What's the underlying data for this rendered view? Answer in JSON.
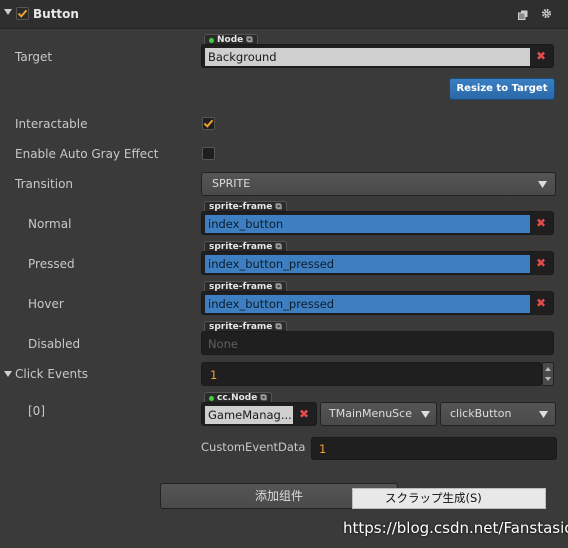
{
  "component": {
    "title": "Button",
    "enabled": true,
    "icons": [
      "copy-icon",
      "gear-icon"
    ]
  },
  "target": {
    "label": "Target",
    "tag": "Node",
    "value": "Background"
  },
  "resize_button": "Resize to Target",
  "interactable": {
    "label": "Interactable",
    "checked": true
  },
  "auto_gray": {
    "label": "Enable Auto Gray Effect",
    "checked": false
  },
  "transition": {
    "label": "Transition",
    "value": "SPRITE"
  },
  "states": [
    {
      "label": "Normal",
      "tag": "sprite-frame",
      "value": "index_button",
      "selected": true
    },
    {
      "label": "Pressed",
      "tag": "sprite-frame",
      "value": "index_button_pressed",
      "selected": true
    },
    {
      "label": "Hover",
      "tag": "sprite-frame",
      "value": "index_button_pressed",
      "selected": true
    },
    {
      "label": "Disabled",
      "tag": "sprite-frame",
      "value": "None",
      "selected": false
    }
  ],
  "click_events": {
    "label": "Click Events",
    "count": "1",
    "item_label": "[0]",
    "node_tag": "cc.Node",
    "node_value": "GameManag...",
    "component": "TMainMenuSce",
    "handler": "clickButton",
    "custom_label": "CustomEventData",
    "custom_value": "1"
  },
  "add_component_button": "添加组件",
  "popup_item": "スクラップ生成(S)",
  "watermark": "https://blog.csdn.net/Fanstasic",
  "colors": {
    "accent_orange": "#f0a030",
    "selected_blue": "#3d7fc0",
    "button_blue": "#2f6fb0",
    "remove_red": "#e24b4b"
  }
}
